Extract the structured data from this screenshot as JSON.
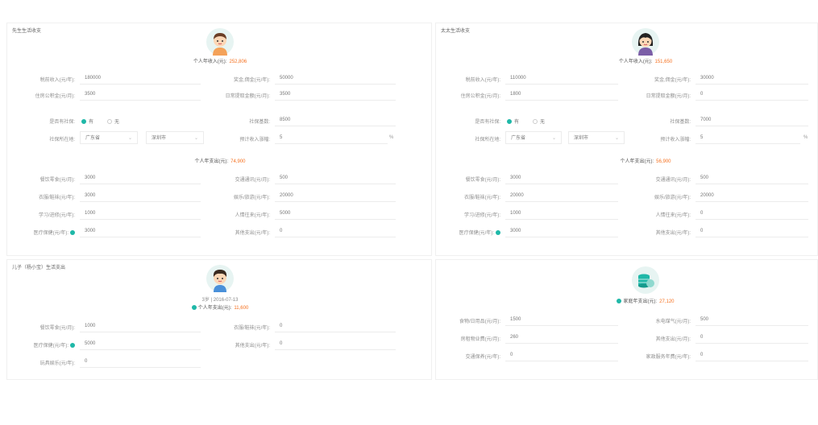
{
  "husband": {
    "title": "先生生活收支",
    "income_label": "个人年收入(元):",
    "income_value": "252,806",
    "pretax_label": "税前收入(元/年):",
    "pretax_value": "180000",
    "bonus_label": "奖金,佣金(元/年):",
    "bonus_value": "50000",
    "housing_label": "住房公积金(元/月):",
    "housing_value": "3500",
    "deduct_label": "日常提取金额(元/月):",
    "deduct_value": "3500",
    "social_label": "是否有社保:",
    "opt_yes": "有",
    "opt_no": "无",
    "social_base_label": "社保基数:",
    "social_base_value": "8500",
    "location_label": "社保所在地:",
    "province": "广东省",
    "city": "深圳市",
    "growth_label": "预计收入涨幅:",
    "growth_value": "5",
    "growth_unit": "%",
    "expense_label": "个人年支出(元):",
    "expense_value": "74,900",
    "food_label": "餐饮零食(元/月):",
    "food_value": "3000",
    "transport_label": "交通通讯(元/月):",
    "transport_value": "500",
    "clothes_label": "衣服/鞋袜(元/年):",
    "clothes_value": "3000",
    "fun_label": "娱乐/旅游(元/年):",
    "fun_value": "20000",
    "study_label": "学习/进修(元/年):",
    "study_value": "1000",
    "gift_label": "人情往来(元/年):",
    "gift_value": "5000",
    "medical_label": "医疗保健(元/年):",
    "medical_value": "3000",
    "other_label": "其他支出(元/年):",
    "other_value": "0"
  },
  "wife": {
    "title": "太太生活收支",
    "income_label": "个人年收入(元):",
    "income_value": "151,650",
    "pretax_label": "税前收入(元/年):",
    "pretax_value": "110000",
    "bonus_label": "奖金,佣金(元/年):",
    "bonus_value": "30000",
    "housing_label": "住房公积金(元/月):",
    "housing_value": "1800",
    "deduct_label": "日常提取金额(元/月):",
    "deduct_value": "0",
    "social_label": "是否有社保:",
    "opt_yes": "有",
    "opt_no": "无",
    "social_base_label": "社保基数:",
    "social_base_value": "7000",
    "location_label": "社保所在地:",
    "province": "广东省",
    "city": "深圳市",
    "growth_label": "预计收入涨幅:",
    "growth_value": "5",
    "growth_unit": "%",
    "expense_label": "个人年支出(元):",
    "expense_value": "56,900",
    "food_label": "餐饮零食(元/月):",
    "food_value": "3000",
    "transport_label": "交通通讯(元/月):",
    "transport_value": "500",
    "clothes_label": "衣服/鞋袜(元/年):",
    "clothes_value": "20000",
    "fun_label": "娱乐/旅游(元/年):",
    "fun_value": "20000",
    "study_label": "学习/进修(元/年):",
    "study_value": "1000",
    "gift_label": "人情往来(元/年):",
    "gift_value": "0",
    "medical_label": "医疗保健(元/年):",
    "medical_value": "3000",
    "other_label": "其他支出(元/年):",
    "other_value": "0"
  },
  "son": {
    "title": "儿子（杨小宝）生活支出",
    "info": "3岁 | 2016-07-13",
    "expense_label": "个人年支出(元):",
    "expense_value": "11,600",
    "food_label": "餐饮零食(元/月):",
    "food_value": "1000",
    "clothes_label": "衣服/鞋袜(元/年):",
    "clothes_value": "0",
    "medical_label": "医疗保健(元/年):",
    "medical_value": "5000",
    "other_label": "其他支出(元/年):",
    "other_value": "0",
    "toys_label": "玩具娱乐(元/年):",
    "toys_value": "0"
  },
  "family": {
    "expense_label": "家庭年支出(元):",
    "expense_value": "27,120",
    "daily_label": "食物/日用品(元/月):",
    "daily_value": "1500",
    "utility_label": "水电煤气(元/月):",
    "utility_value": "500",
    "property_label": "房租物业费(元/月):",
    "property_value": "260",
    "other_label": "其他支出(元/月):",
    "other_value": "0",
    "vehicle_label": "交通保养(元/年):",
    "vehicle_value": "0",
    "nanny_label": "家政服务年费(元/年):",
    "nanny_value": "0"
  },
  "colors": {
    "accent": "#1fb8a8",
    "highlight": "#f5701f"
  }
}
